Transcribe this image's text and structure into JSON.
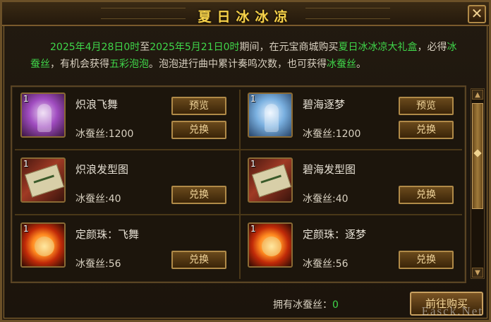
{
  "window": {
    "title": "夏日冰冰凉",
    "close_label": "✕"
  },
  "intro": {
    "date_start": "2025年4月28日0时",
    "to": "至",
    "date_end": "2025年5月21日0时",
    "part1": "期间，在元宝商城购买",
    "gift_box": "夏日冰冰凉大礼盒",
    "part2": "，必得",
    "silk": "冰蚕丝",
    "part3": "，有机会获得",
    "bubble": "五彩泡泡",
    "part4": "。泡泡进行曲中累计奏鸣次数，也可获得",
    "silk2": "冰蚕丝",
    "part5": "。"
  },
  "items": [
    {
      "name": "炽浪飞舞",
      "cost": "冰蚕丝:1200",
      "count": "1",
      "preview": "预览",
      "exchange": "兑换",
      "icon": "dress-pink-icon"
    },
    {
      "name": "碧海逐梦",
      "cost": "冰蚕丝:1200",
      "count": "1",
      "preview": "预览",
      "exchange": "兑换",
      "icon": "dress-blue-icon"
    },
    {
      "name": "炽浪发型图",
      "cost": "冰蚕丝:40",
      "count": "1",
      "exchange": "兑换",
      "icon": "scroll-icon"
    },
    {
      "name": "碧海发型图",
      "cost": "冰蚕丝:40",
      "count": "1",
      "exchange": "兑换",
      "icon": "scroll-icon"
    },
    {
      "name": "定颜珠：飞舞",
      "cost": "冰蚕丝:56",
      "count": "1",
      "exchange": "兑换",
      "icon": "orb-icon"
    },
    {
      "name": "定颜珠：逐梦",
      "cost": "冰蚕丝:56",
      "count": "1",
      "exchange": "兑换",
      "icon": "orb-icon"
    }
  ],
  "footer": {
    "owned_label": "拥有冰蚕丝：",
    "owned_value": "0",
    "goto_label": "前往购买"
  },
  "scrollbar": {
    "up": "▲",
    "down": "▼",
    "position": 0.0
  },
  "watermark": "Easck.Net"
}
